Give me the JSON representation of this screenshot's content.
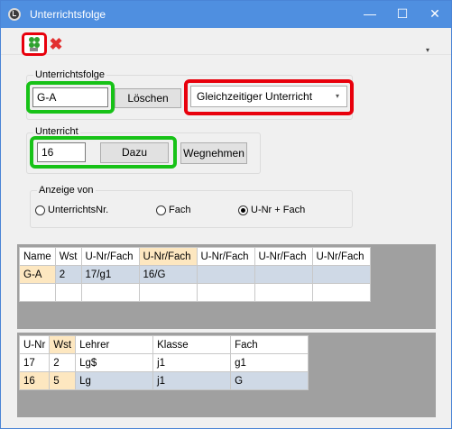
{
  "window": {
    "title": "Unterrichtsfolge",
    "minimize": "—",
    "maximize": "☐",
    "close": "✕"
  },
  "toolbar": {
    "delete_glyph": "✖",
    "overflow_glyph": "▾"
  },
  "unterrichtsfolge": {
    "label": "Unterrichtsfolge",
    "value": "G-A",
    "delete_label": "Löschen",
    "mode_selected": "Gleichzeitiger Unterricht"
  },
  "unterricht": {
    "label": "Unterricht",
    "value": "16",
    "add_label": "Dazu",
    "remove_label": "Wegnehmen"
  },
  "anzeige": {
    "label": "Anzeige von",
    "options": [
      "UnterrichtsNr.",
      "Fach",
      "U-Nr + Fach"
    ],
    "selected_index": 2
  },
  "top_grid": {
    "headers": [
      "Name",
      "Wst",
      "U-Nr/Fach",
      "U-Nr/Fach",
      "U-Nr/Fach",
      "U-Nr/Fach",
      "U-Nr/Fach"
    ],
    "rows": [
      [
        "G-A",
        "2",
        "17/g1",
        "16/G",
        "",
        "",
        ""
      ],
      [
        "",
        "",
        "",
        "",
        "",
        "",
        ""
      ]
    ]
  },
  "bottom_grid": {
    "headers": [
      "U-Nr",
      "Wst",
      "Lehrer",
      "Klasse",
      "Fach"
    ],
    "rows": [
      [
        "17",
        "2",
        "Lg$",
        "j1",
        "g1"
      ],
      [
        "16",
        "5",
        "Lg",
        "j1",
        "G"
      ]
    ]
  },
  "colors": {
    "titlebar": "#4f8fe0",
    "highlight_green": "#17c217",
    "highlight_red": "#e8000c",
    "column_highlight": "#fde7c0"
  }
}
